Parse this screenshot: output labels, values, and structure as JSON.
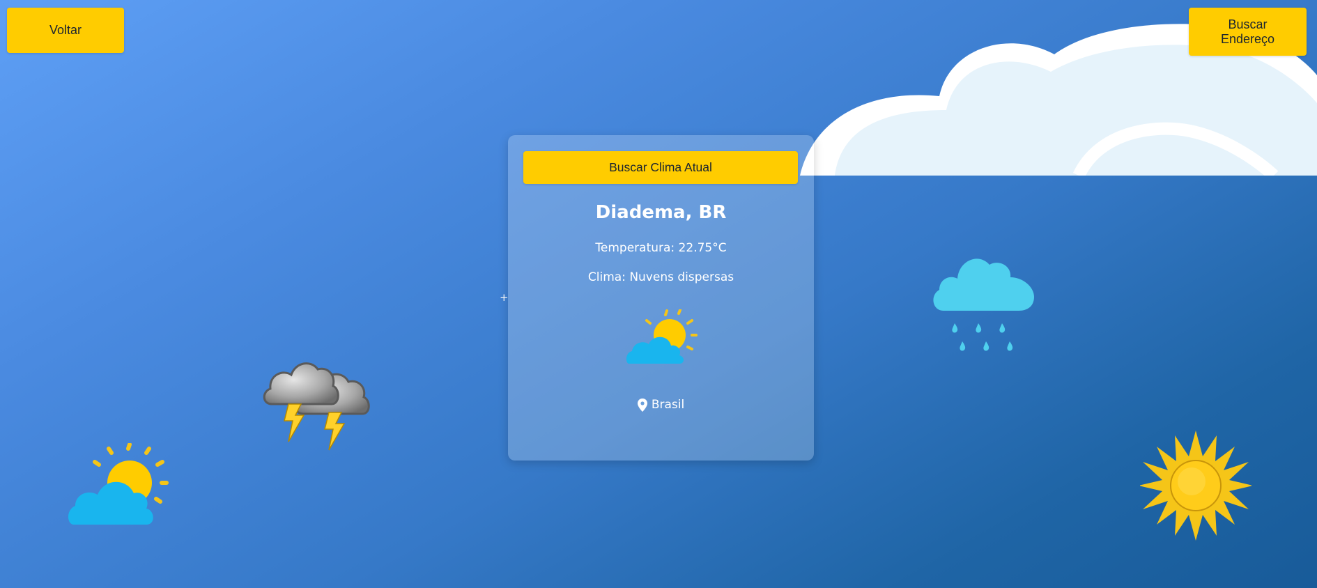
{
  "nav": {
    "back_label": "Voltar",
    "address_label": "Buscar Endereço"
  },
  "card": {
    "search_label": "Buscar Clima Atual",
    "city": "Diadema, BR",
    "temperature": "Temperatura: 22.75°C",
    "condition": "Clima: Nuvens dispersas",
    "country": "Brasil",
    "weather_icon": "partly-cloudy-icon"
  },
  "misc": {
    "plus": "+"
  },
  "decorations": [
    "large-cloud-icon",
    "rain-cloud-icon",
    "sun-icon",
    "storm-clouds-icon",
    "partly-cloudy-icon"
  ],
  "colors": {
    "accent": "#ffcc00",
    "cloud": "#e8f4fc",
    "rain_cloud": "#4fd0ee",
    "sun": "#f5c518",
    "small_cloud": "#19b5ee"
  }
}
